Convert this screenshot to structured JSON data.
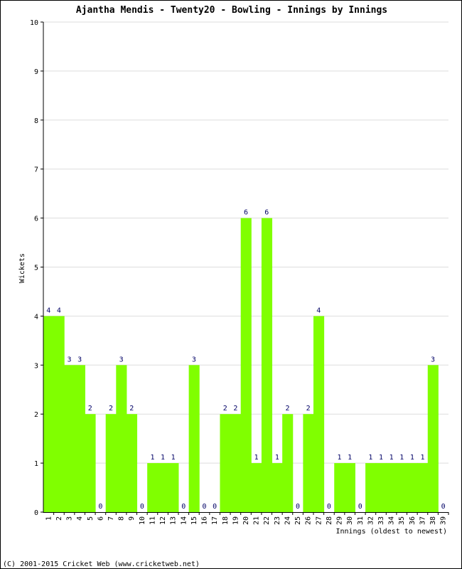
{
  "chart_data": {
    "type": "bar",
    "title": "Ajantha Mendis - Twenty20 - Bowling - Innings by Innings",
    "xlabel": "Innings (oldest to newest)",
    "ylabel": "Wickets",
    "ylim": [
      0,
      10
    ],
    "yticks": [
      "0",
      "1",
      "2",
      "3",
      "4",
      "5",
      "6",
      "7",
      "8",
      "9",
      "10"
    ],
    "grid": true,
    "legend": "none",
    "bar_color": "#80ff00",
    "value_label_color": "#000066",
    "categories": [
      "1",
      "2",
      "3",
      "4",
      "5",
      "6",
      "7",
      "8",
      "9",
      "10",
      "11",
      "12",
      "13",
      "14",
      "15",
      "16",
      "17",
      "18",
      "19",
      "20",
      "21",
      "22",
      "23",
      "24",
      "25",
      "26",
      "27",
      "28",
      "29",
      "30",
      "31",
      "32",
      "33",
      "34",
      "35",
      "36",
      "37",
      "38",
      "39"
    ],
    "values": [
      4,
      4,
      3,
      3,
      2,
      0,
      2,
      3,
      2,
      0,
      1,
      1,
      1,
      0,
      3,
      0,
      0,
      2,
      2,
      6,
      1,
      6,
      1,
      2,
      0,
      2,
      4,
      0,
      1,
      1,
      0,
      1,
      1,
      1,
      1,
      1,
      1,
      3,
      0
    ]
  },
  "footer": "(C) 2001-2015 Cricket Web (www.cricketweb.net)"
}
